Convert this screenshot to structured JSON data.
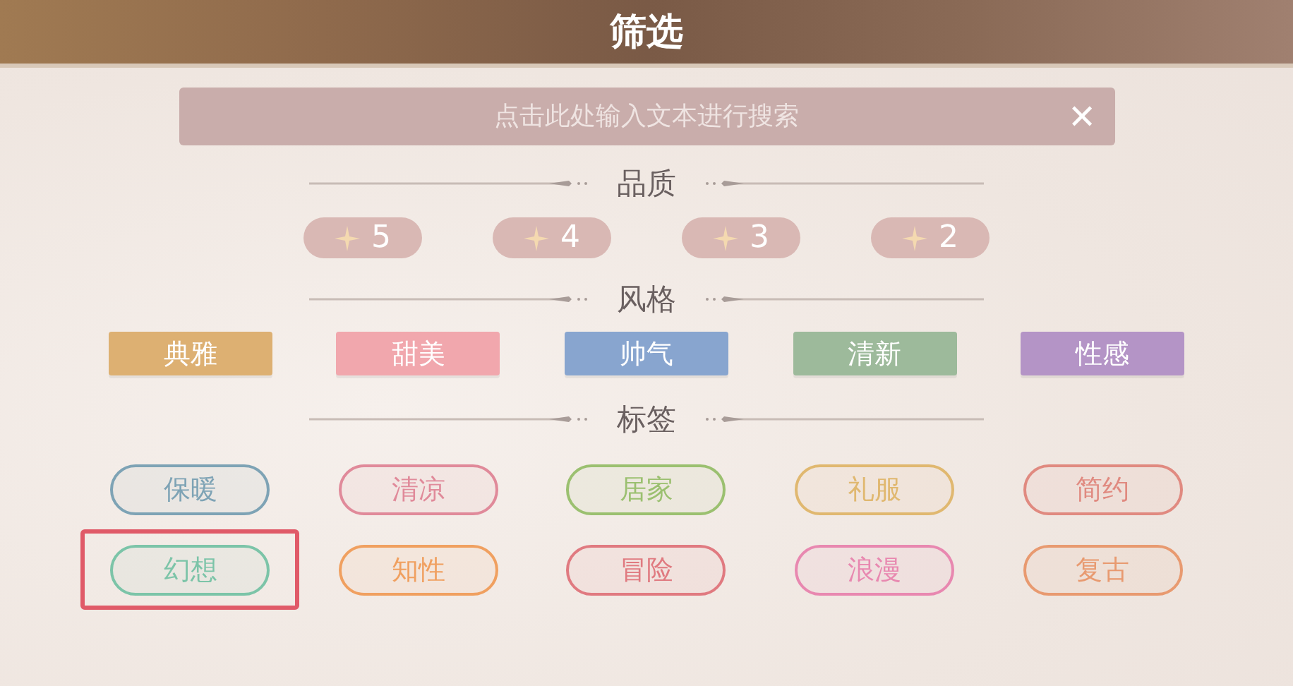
{
  "window": {
    "title": "筛选"
  },
  "search": {
    "placeholder": "点击此处输入文本进行搜索",
    "clear": "✕"
  },
  "sections": [
    {
      "kind": "stars",
      "title": "品质",
      "items": [
        {
          "label": "5",
          "selected": false
        },
        {
          "label": "4",
          "selected": false
        },
        {
          "label": "3",
          "selected": false
        },
        {
          "label": "2",
          "selected": false
        }
      ]
    },
    {
      "kind": "styles",
      "title": "风格",
      "items": [
        {
          "label": "典雅",
          "color": "#ddb072",
          "selected": false
        },
        {
          "label": "甜美",
          "color": "#f1a7ad",
          "selected": false
        },
        {
          "label": "帅气",
          "color": "#88a5cf",
          "selected": false
        },
        {
          "label": "清新",
          "color": "#9dba9b",
          "selected": false
        },
        {
          "label": "性感",
          "color": "#b494c6",
          "selected": false
        }
      ]
    },
    {
      "kind": "tags",
      "title": "标签",
      "items": [
        {
          "label": "保暖",
          "color": "#7ea3b5",
          "selected": false
        },
        {
          "label": "清凉",
          "color": "#e08a9a",
          "selected": false
        },
        {
          "label": "居家",
          "color": "#9bc070",
          "selected": false
        },
        {
          "label": "礼服",
          "color": "#e0b870",
          "selected": false
        },
        {
          "label": "简约",
          "color": "#e08a80",
          "selected": false
        },
        {
          "label": "幻想",
          "color": "#7cc4a8",
          "selected": true
        },
        {
          "label": "知性",
          "color": "#f0a060",
          "selected": false
        },
        {
          "label": "冒险",
          "color": "#e07a80",
          "selected": false
        },
        {
          "label": "浪漫",
          "color": "#e888b0",
          "selected": false
        },
        {
          "label": "复古",
          "color": "#e89a70",
          "selected": false
        }
      ]
    }
  ]
}
